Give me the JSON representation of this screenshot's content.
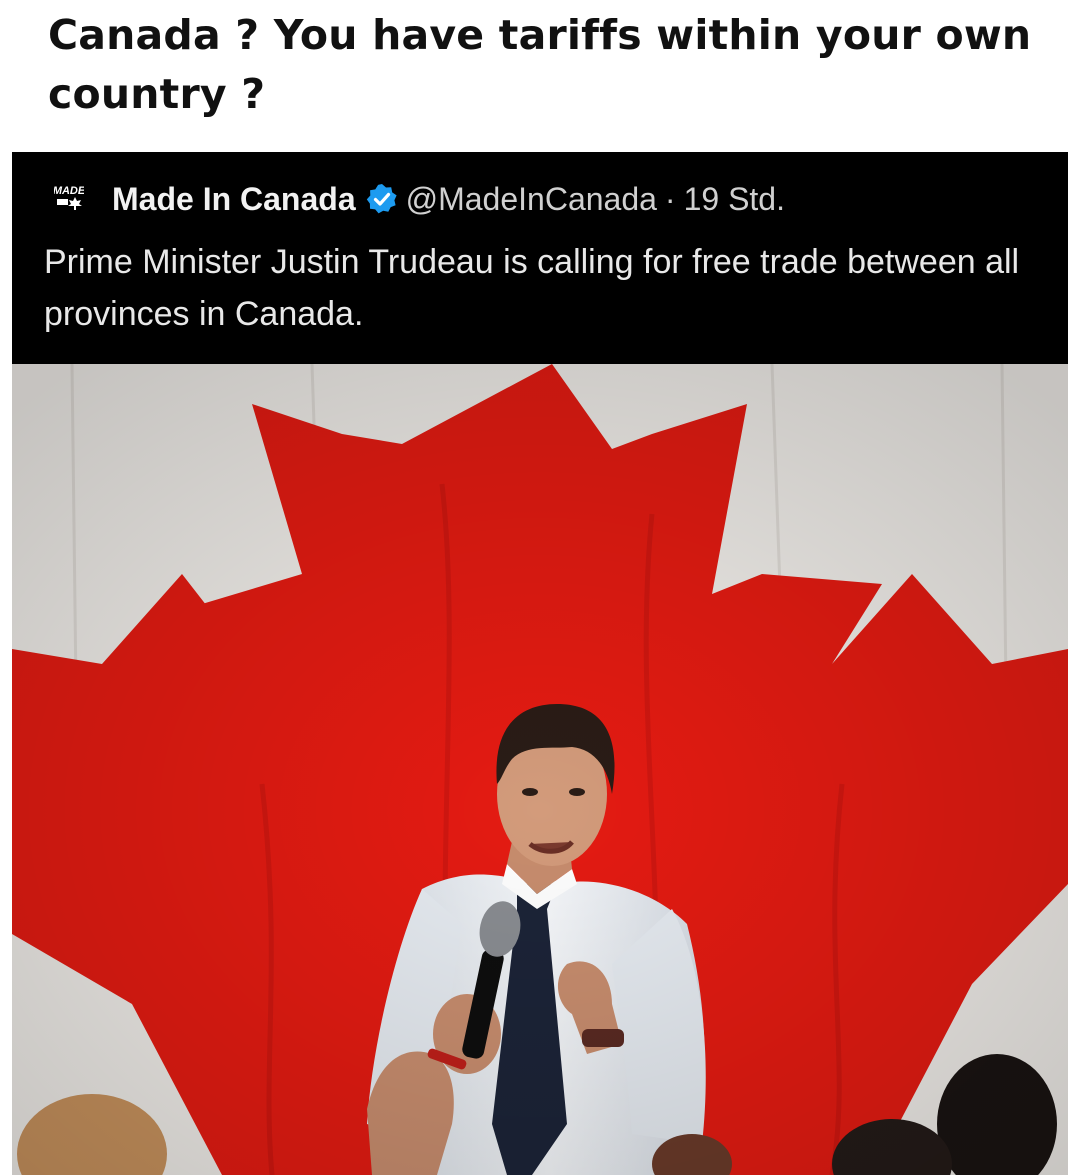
{
  "caption": "Canada ? You have tariffs within your own country ?",
  "tweet": {
    "author_name": "Made In Canada",
    "handle": "@MadeInCanada",
    "separator": "·",
    "time": "19 Std.",
    "text": "Prime Minister Justin Trudeau is calling for free trade between all provinces in Canada.",
    "verified": true,
    "logo_text": "MADE"
  },
  "photo": {
    "subject": "speaker-with-microphone",
    "backdrop": "canadian-flag-maple-leaf"
  },
  "colors": {
    "flag_red": "#e51b12",
    "flag_white": "#f1eeea",
    "verified_blue": "#1d9bf0",
    "card_background": "#000000"
  }
}
